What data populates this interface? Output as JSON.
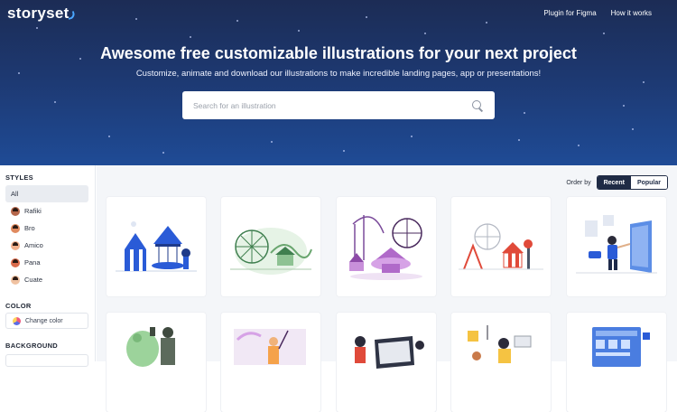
{
  "brand": {
    "logo": "storyset"
  },
  "nav": {
    "items": [
      "Plugin for Figma",
      "How it works"
    ]
  },
  "hero": {
    "title": "Awesome free customizable illustrations for your next project",
    "subtitle": "Customize, animate and download our illustrations to make incredible landing pages, app or presentations!",
    "search_placeholder": "Search for an illustration"
  },
  "sidebar": {
    "styles_title": "STYLES",
    "styles": [
      {
        "label": "All",
        "active": true
      },
      {
        "label": "Rafiki",
        "avatar_color": "#b5664a"
      },
      {
        "label": "Bro",
        "avatar_color": "#e08a5f"
      },
      {
        "label": "Amico",
        "avatar_color": "#f2b08c"
      },
      {
        "label": "Pana",
        "avatar_color": "#d96b4b"
      },
      {
        "label": "Cuate",
        "avatar_color": "#f0c2a1"
      }
    ],
    "color_title": "COLOR",
    "change_color": "Change color",
    "background_title": "BACKGROUND"
  },
  "order": {
    "label": "Order by",
    "options": [
      "Recent",
      "Popular"
    ],
    "selected": "Recent"
  },
  "colors": {
    "accent": "#1f2b45",
    "hero_top": "#1c2c55",
    "hero_bottom": "#1f4b96"
  },
  "illustrations": [
    {
      "name": "carousel-circus-illustration",
      "theme": "blue"
    },
    {
      "name": "ferris-wheel-park-illustration",
      "theme": "green"
    },
    {
      "name": "amusement-park-illustration",
      "theme": "purple"
    },
    {
      "name": "fairground-rides-illustration",
      "theme": "red"
    },
    {
      "name": "person-with-screen-illustration",
      "theme": "blue"
    },
    {
      "name": "green-characters-illustration",
      "theme": "green"
    },
    {
      "name": "person-painting-illustration",
      "theme": "purple"
    },
    {
      "name": "people-with-tablet-illustration",
      "theme": "red"
    },
    {
      "name": "people-working-illustration",
      "theme": "yellow"
    },
    {
      "name": "dashboard-interface-illustration",
      "theme": "blue"
    }
  ]
}
